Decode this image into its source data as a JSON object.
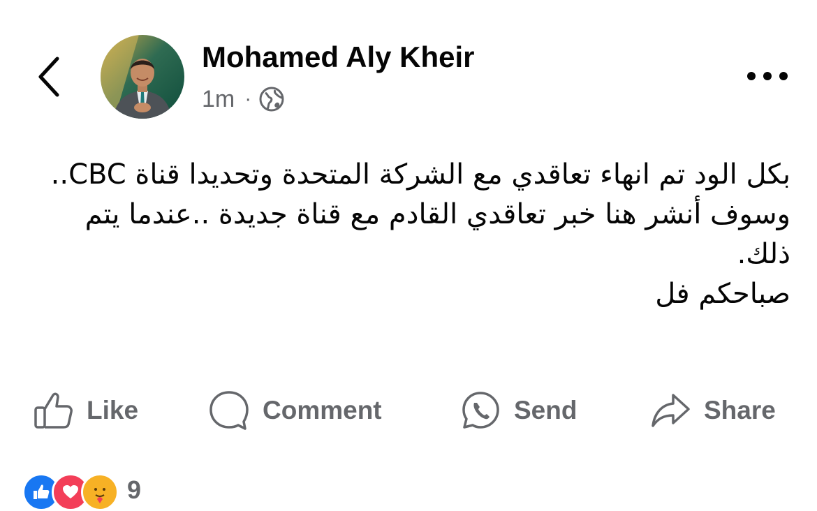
{
  "post": {
    "author": "Mohamed Aly Kheir",
    "time": "1m",
    "separator": "·",
    "audience_icon": "globe-icon",
    "text_lines": [
      "بكل الود تم انهاء تعاقدي مع الشركة المتحدة وتحديدا قناة CBC..",
      "وسوف أنشر هنا خبر تعاقدي القادم مع قناة جديدة ..عندما يتم ذلك.",
      "صباحكم فل"
    ]
  },
  "actions": {
    "like": "Like",
    "comment": "Comment",
    "send": "Send",
    "share": "Share"
  },
  "reactions": {
    "icons": [
      "like-reaction-icon",
      "love-reaction-icon",
      "care-reaction-icon"
    ],
    "count": "9"
  },
  "colors": {
    "text_primary": "#050505",
    "text_secondary": "#65676b",
    "like_blue": "#1877f2",
    "love_red": "#f33e58",
    "care_yellow": "#f7b125"
  }
}
